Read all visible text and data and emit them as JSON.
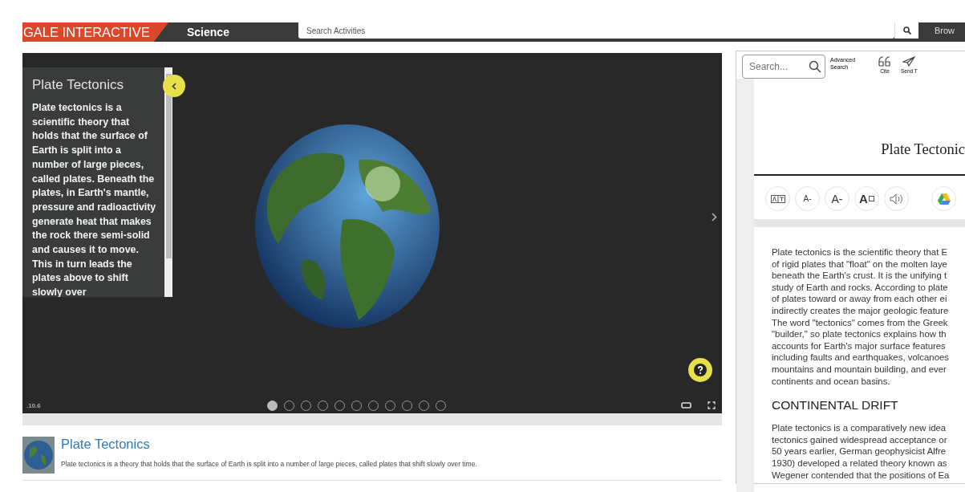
{
  "header": {
    "logo": "GALE INTERACTIVE",
    "section": "Science",
    "search": {
      "placeholder": "Search Activities"
    },
    "browse_button": "Brow"
  },
  "viewer": {
    "info_panel": {
      "title": "Plate Tectonics",
      "text": "Plate tectonics is a scientific theory that holds that the surface of Earth is split into a number of large pieces, called plates. Beneath the plates, in Earth's mantle, pressure and radioactivity generate heat that makes the rock there semi-solid and causes it to move. This in turn leads the plates above to shift slowly over"
    },
    "version": ".10.6",
    "slides": [
      {
        "selected": true
      },
      {
        "selected": false
      },
      {
        "selected": false
      },
      {
        "selected": false
      },
      {
        "selected": false
      },
      {
        "selected": false
      },
      {
        "selected": false
      },
      {
        "selected": false
      },
      {
        "selected": false
      },
      {
        "selected": false
      },
      {
        "selected": false
      }
    ]
  },
  "summary": {
    "title": "Plate Tectonics",
    "description": "Plate tectonics is a theory that holds that the surface of Earth is split into a number of large pieces, called plates that shift slowly over time."
  },
  "article_panel": {
    "search": {
      "placeholder": "Search..."
    },
    "advanced_search": "Advanced Search",
    "tools": [
      {
        "kind": "cite",
        "label": "Cite"
      },
      {
        "kind": "send",
        "label": "Send T"
      }
    ],
    "title": "Plate Tectonic",
    "reader_tools": [
      {
        "kind": "translate"
      },
      {
        "kind": "smaller",
        "label": "A-"
      },
      {
        "kind": "larger",
        "label": "A-"
      },
      {
        "kind": "font",
        "label": "A"
      },
      {
        "kind": "listen"
      },
      {
        "kind": "drive"
      }
    ],
    "sections": [
      {
        "kind": "paragraph",
        "lines": [
          "Plate tectonics is the scientific theory that E",
          "of rigid plates that \"float\" on the molten laye",
          "beneath the Earth's crust. It is the unifying t",
          "study of Earth and rocks. According to plate",
          "of plates toward or away from each other ei",
          "indirectly creates the major geologic feature",
          "The word \"tectonics\" comes from the Greek",
          "\"builder,\" so plate tectonics explains how th",
          "accounts for Earth's major surface features",
          "including faults and earthquakes, volcanoes",
          "mountains and mountain building, and ever",
          "continents and ocean basins."
        ]
      },
      {
        "kind": "heading",
        "lines": [
          "CONTINENTAL DRIFT"
        ]
      },
      {
        "kind": "paragraph",
        "lines": [
          "Plate tectonics is a comparatively new idea",
          "tectonics gained widespread acceptance or",
          "50 years earlier, German geophysicist Alfre",
          "1930) developed a related theory known as",
          "Wegener contended that the positions of Ea"
        ]
      }
    ]
  }
}
